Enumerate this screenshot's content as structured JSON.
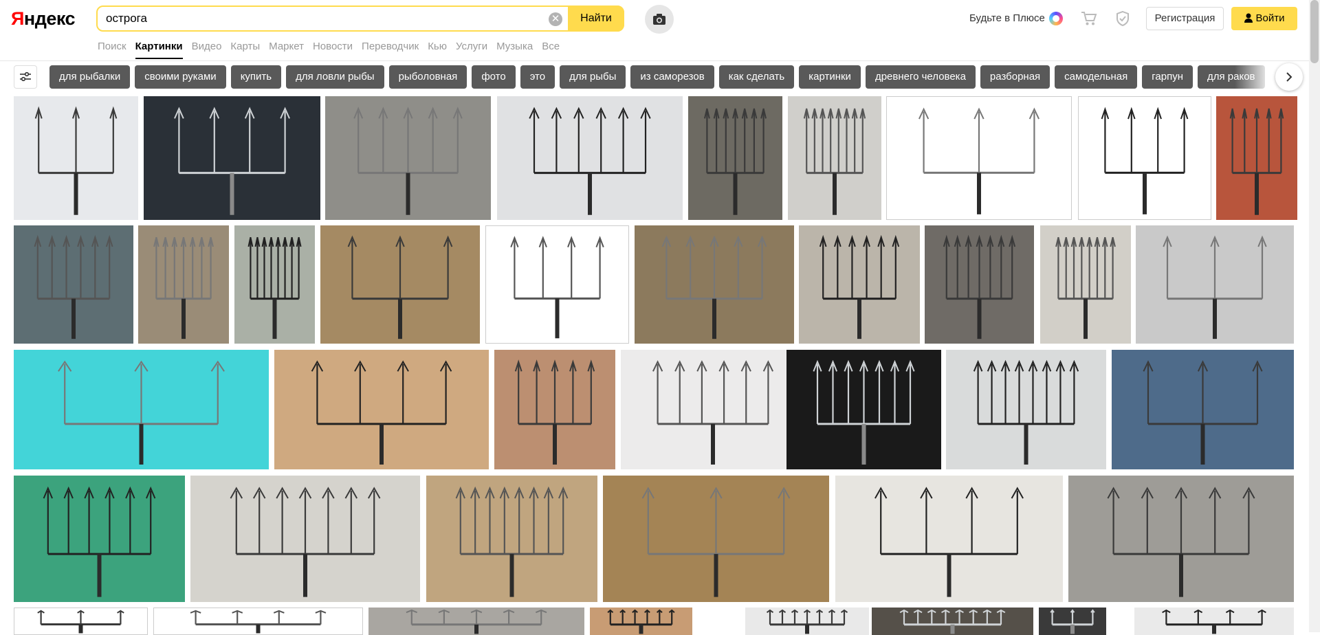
{
  "logo": {
    "first": "Я",
    "rest": "ндекс"
  },
  "search": {
    "query": "острога",
    "button_label": "Найти",
    "clear_glyph": "✕"
  },
  "header": {
    "plus_text": "Будьте в Плюсе",
    "register_label": "Регистрация",
    "login_label": "Войти"
  },
  "nav": [
    "Поиск",
    "Картинки",
    "Видео",
    "Карты",
    "Маркет",
    "Новости",
    "Переводчик",
    "Кью",
    "Услуги",
    "Музыка",
    "Все"
  ],
  "nav_active": "Картинки",
  "tags": [
    "для рыбалки",
    "своими руками",
    "купить",
    "для ловли рыбы",
    "рыболовная",
    "фото",
    "это",
    "для рыбы",
    "из саморезов",
    "как сделать",
    "картинки",
    "древнего человека",
    "разборная",
    "самодельная",
    "гарпун",
    "для раков"
  ],
  "icons": {
    "search_clear": "close-icon",
    "camera": "camera-icon",
    "cart": "cart-icon",
    "shield": "shield-icon",
    "plus": "plus-icon",
    "login": "person-icon",
    "filter": "sliders-icon",
    "next": "chevron-right-icon"
  },
  "colors": {
    "accent": "#ffdb4d",
    "tag_bg": "#595959",
    "brand_red": "#ff0000"
  },
  "image_rows": [
    [
      "#e7e9ec",
      "#2a3037",
      "#8f8e89",
      "#e0e1e3",
      "#6d6a62",
      "#d0cfcb",
      "#ffffff",
      "#ffffff",
      "#b8553c"
    ],
    [
      "#5d6e73",
      "#9a8c77",
      "#aab0a6",
      "#a58a63",
      "#ffffff",
      "#8c7a5d",
      "#bbb5aa",
      "#6f6b66",
      "#d2cfc8",
      "#c9c9c9"
    ],
    [
      "#43d4d8",
      "#cfa980",
      "#bc8f71",
      "#ecebeb",
      "#1a1a1a",
      "#d9dbdb",
      "#4e6b8a"
    ],
    [
      "#3ca37d",
      "#d5d3cd",
      "#c0a57f",
      "#a48455",
      "#e7e5e0",
      "#9e9c97"
    ],
    [
      "#ffffff",
      "#ffffff",
      "#a9a6a1",
      "#c89c74",
      "#e9e9e9",
      "#555049",
      "#3a3a3a",
      "#eaeaea"
    ]
  ]
}
